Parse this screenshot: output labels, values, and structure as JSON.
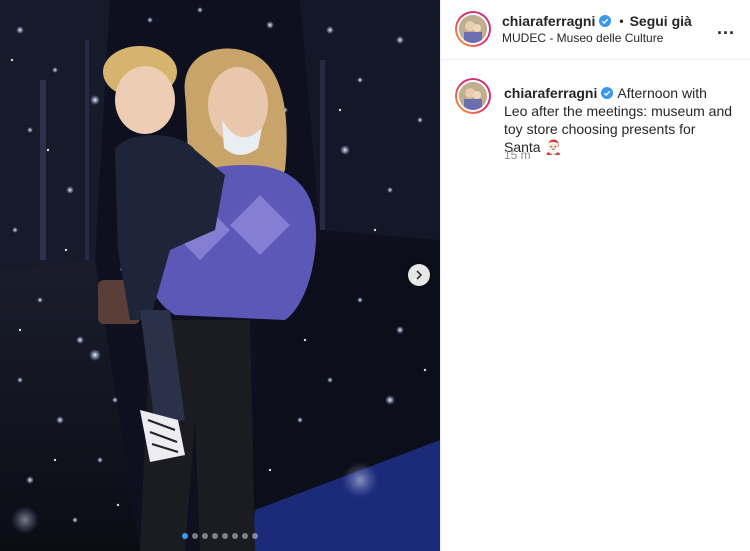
{
  "post": {
    "username": "chiaraferragni",
    "follow_label": "Segui già",
    "separator": "•",
    "location": "MUDEC - Museo delle Culture",
    "more_label": "...",
    "caption_text": "Afternoon with Leo after the meetings: museum and toy store choosing presents for Santa 🎅🏻",
    "time": "15 m"
  },
  "carousel": {
    "slide_count": 8,
    "active_index": 0
  },
  "colors": {
    "verified": "#3897f0",
    "active_dot": "#3a9bef"
  }
}
